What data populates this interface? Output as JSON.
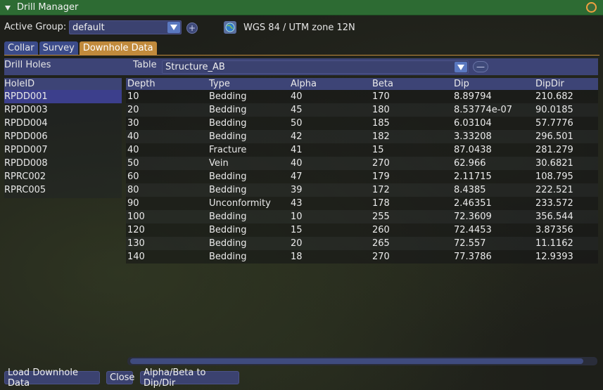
{
  "window": {
    "title": "Drill Manager"
  },
  "active_group": {
    "label": "Active Group:",
    "value": "default"
  },
  "crs": {
    "label": "WGS 84 / UTM zone 12N"
  },
  "tabs": [
    {
      "label": "Collar"
    },
    {
      "label": "Survey"
    },
    {
      "label": "Downhole Data"
    }
  ],
  "panel": {
    "drill_holes_label": "Drill Holes",
    "table_label": "Table",
    "table_value": "Structure_AB"
  },
  "holes": {
    "header": "HoleID",
    "items": [
      "RPDD001",
      "RPDD003",
      "RPDD004",
      "RPDD006",
      "RPDD007",
      "RPDD008",
      "RPRC002",
      "RPRC005"
    ],
    "selected_index": 0
  },
  "table": {
    "columns": [
      "Depth",
      "Type",
      "Alpha",
      "Beta",
      "Dip",
      "DipDir"
    ],
    "rows": [
      [
        "10",
        "Bedding",
        "40",
        "170",
        "8.89794",
        "210.682"
      ],
      [
        "20",
        "Bedding",
        "45",
        "180",
        "8.53774e-07",
        "90.0185"
      ],
      [
        "30",
        "Bedding",
        "50",
        "185",
        "6.03104",
        "57.7776"
      ],
      [
        "40",
        "Bedding",
        "42",
        "182",
        "3.33208",
        "296.501"
      ],
      [
        "40",
        "Fracture",
        "41",
        "15",
        "87.0438",
        "281.279"
      ],
      [
        "50",
        "Vein",
        "40",
        "270",
        "62.966",
        "30.6821"
      ],
      [
        "60",
        "Bedding",
        "47",
        "179",
        "2.11715",
        "108.795"
      ],
      [
        "80",
        "Bedding",
        "39",
        "172",
        "8.4385",
        "222.521"
      ],
      [
        "90",
        "Unconformity",
        "43",
        "178",
        "2.46351",
        "233.572"
      ],
      [
        "100",
        "Bedding",
        "10",
        "255",
        "72.3609",
        "356.544"
      ],
      [
        "120",
        "Bedding",
        "15",
        "260",
        "72.4453",
        "3.87356"
      ],
      [
        "130",
        "Bedding",
        "20",
        "265",
        "72.557",
        "11.1162"
      ],
      [
        "140",
        "Bedding",
        "18",
        "270",
        "77.3786",
        "12.9393"
      ]
    ]
  },
  "buttons": {
    "load": "Load Downhole Data",
    "close": "Close",
    "convert": "Alpha/Beta to Dip/Dir"
  },
  "icons": {
    "title_arrow": "triangle-down-icon",
    "title_close": "close-circle-icon",
    "combo_arrow": "chevron-down-icon",
    "add": "plus-icon",
    "remove": "minus-icon",
    "globe": "globe-icon"
  },
  "colors": {
    "titlebar": "#2d6b33",
    "active_tab": "#c18a3c",
    "tab": "#3b4b8a",
    "header": "#3d4476",
    "selection": "#3c3f8c"
  }
}
